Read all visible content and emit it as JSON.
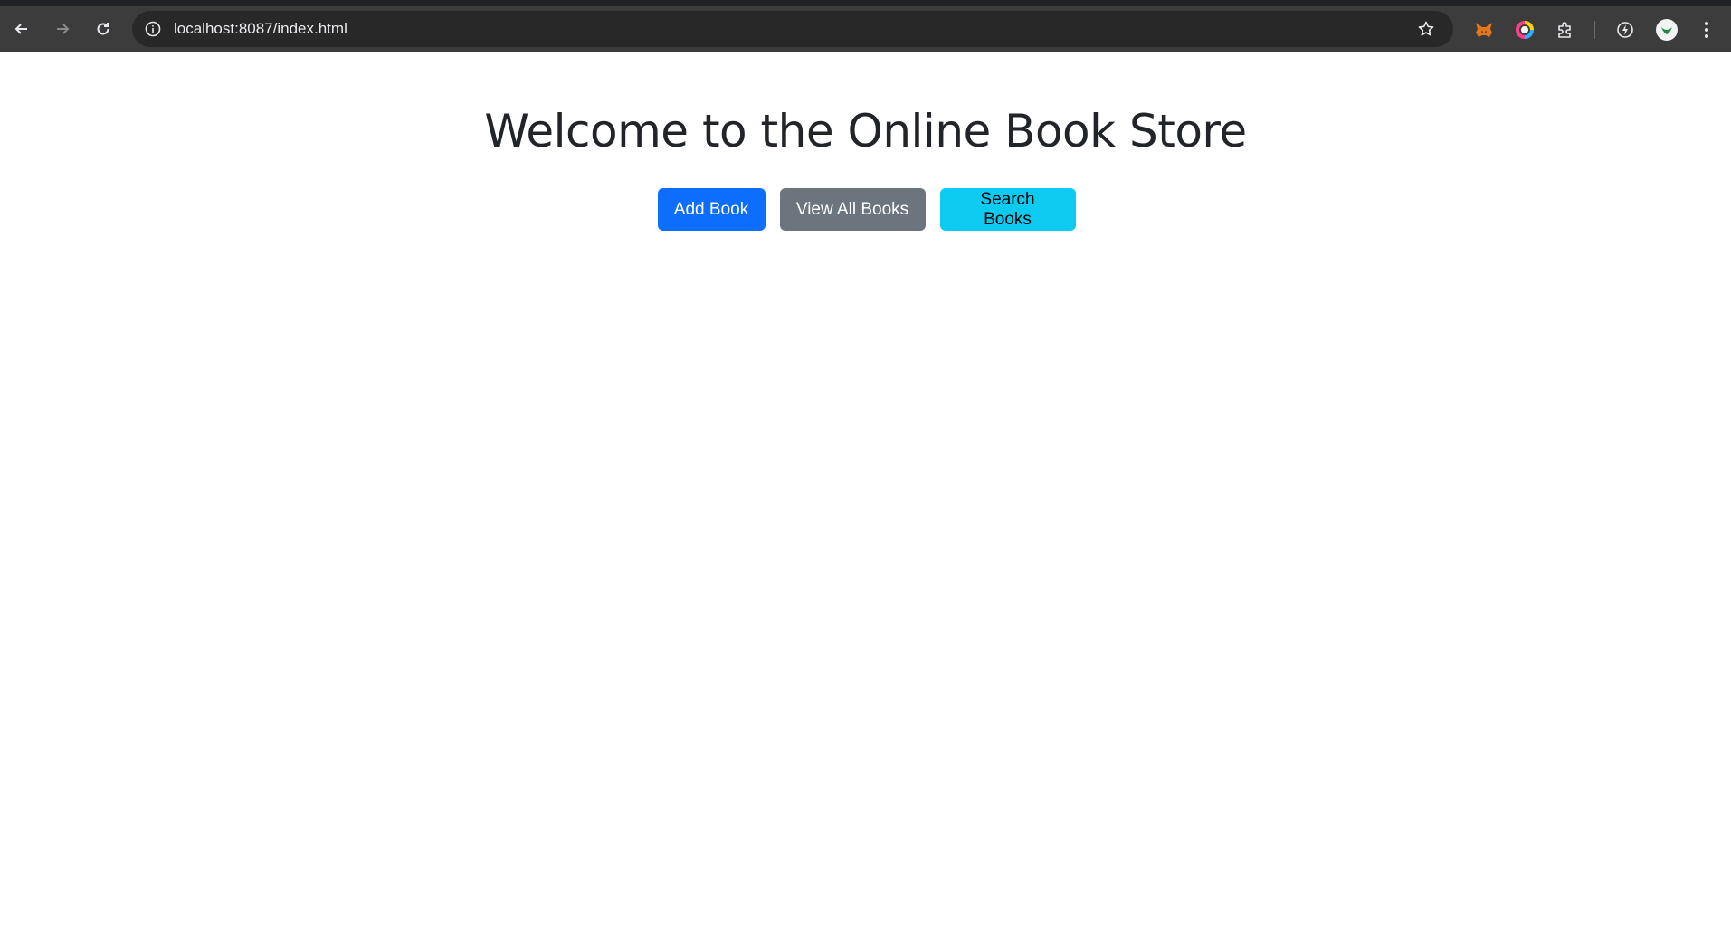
{
  "browser": {
    "url": "localhost:8087/index.html",
    "icons": {
      "back": "arrow-left-icon",
      "forward": "arrow-right-icon",
      "reload": "reload-icon",
      "site_info": "info-icon",
      "bookmark": "star-icon",
      "extensions": [
        "metamask-fox-icon",
        "color-ring-icon",
        "puzzle-piece-icon",
        "performance-icon",
        "profile-avatar-icon",
        "kebab-menu-icon"
      ]
    }
  },
  "page": {
    "heading": "Welcome to the Online Book Store",
    "buttons": {
      "add_book": "Add Book",
      "view_all_books": "View All Books",
      "search_books": "Search Books"
    }
  },
  "colors": {
    "primary": "#0d6efd",
    "secondary": "#6c757d",
    "info": "#0dcaf0",
    "text": "#212529"
  }
}
